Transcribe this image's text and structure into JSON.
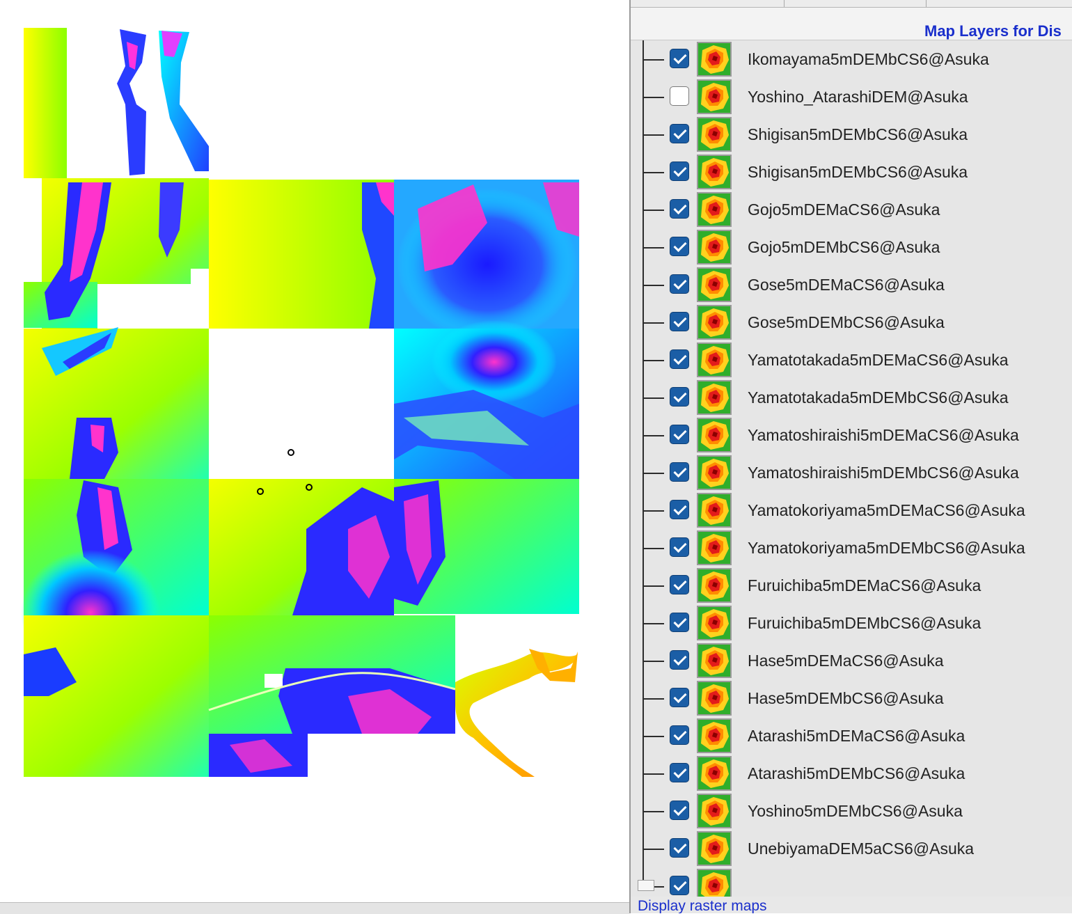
{
  "panel": {
    "title": "Map Layers for Dis",
    "bottom_link": "Display raster maps"
  },
  "layers": [
    {
      "name": "Ikomayama5mDEMbCS6@Asuka",
      "checked": true
    },
    {
      "name": "Yoshino_AtarashiDEM@Asuka",
      "checked": false
    },
    {
      "name": "Shigisan5mDEMbCS6@Asuka",
      "checked": true
    },
    {
      "name": "Shigisan5mDEMbCS6@Asuka",
      "checked": true
    },
    {
      "name": "Gojo5mDEMaCS6@Asuka",
      "checked": true
    },
    {
      "name": "Gojo5mDEMbCS6@Asuka",
      "checked": true
    },
    {
      "name": "Gose5mDEMaCS6@Asuka",
      "checked": true
    },
    {
      "name": "Gose5mDEMbCS6@Asuka",
      "checked": true
    },
    {
      "name": "Yamatotakada5mDEMaCS6@Asuka",
      "checked": true
    },
    {
      "name": "Yamatotakada5mDEMbCS6@Asuka",
      "checked": true
    },
    {
      "name": "Yamatoshiraishi5mDEMaCS6@Asuka",
      "checked": true
    },
    {
      "name": "Yamatoshiraishi5mDEMbCS6@Asuka",
      "checked": true
    },
    {
      "name": "Yamatokoriyama5mDEMaCS6@Asuka",
      "checked": true
    },
    {
      "name": "Yamatokoriyama5mDEMbCS6@Asuka",
      "checked": true
    },
    {
      "name": "Furuichiba5mDEMaCS6@Asuka",
      "checked": true
    },
    {
      "name": "Furuichiba5mDEMbCS6@Asuka",
      "checked": true
    },
    {
      "name": "Hase5mDEMaCS6@Asuka",
      "checked": true
    },
    {
      "name": "Hase5mDEMbCS6@Asuka",
      "checked": true
    },
    {
      "name": "Atarashi5mDEMaCS6@Asuka",
      "checked": true
    },
    {
      "name": "Atarashi5mDEMbCS6@Asuka",
      "checked": true
    },
    {
      "name": "Yoshino5mDEMbCS6@Asuka",
      "checked": true
    },
    {
      "name": "UnebiyamaDEM5aCS6@Asuka",
      "checked": true
    },
    {
      "name": "",
      "checked": true
    }
  ],
  "icons": {
    "thumbnail": "raster-map-icon",
    "checkbox": "checkbox-icon"
  },
  "colors": {
    "panel_title": "#1a2fcc",
    "checkbox_on": "#1b5ea6",
    "elevation_ramp": [
      "#ffff00",
      "#7fff00",
      "#00ffff",
      "#1a1aff",
      "#ff33cc"
    ]
  }
}
